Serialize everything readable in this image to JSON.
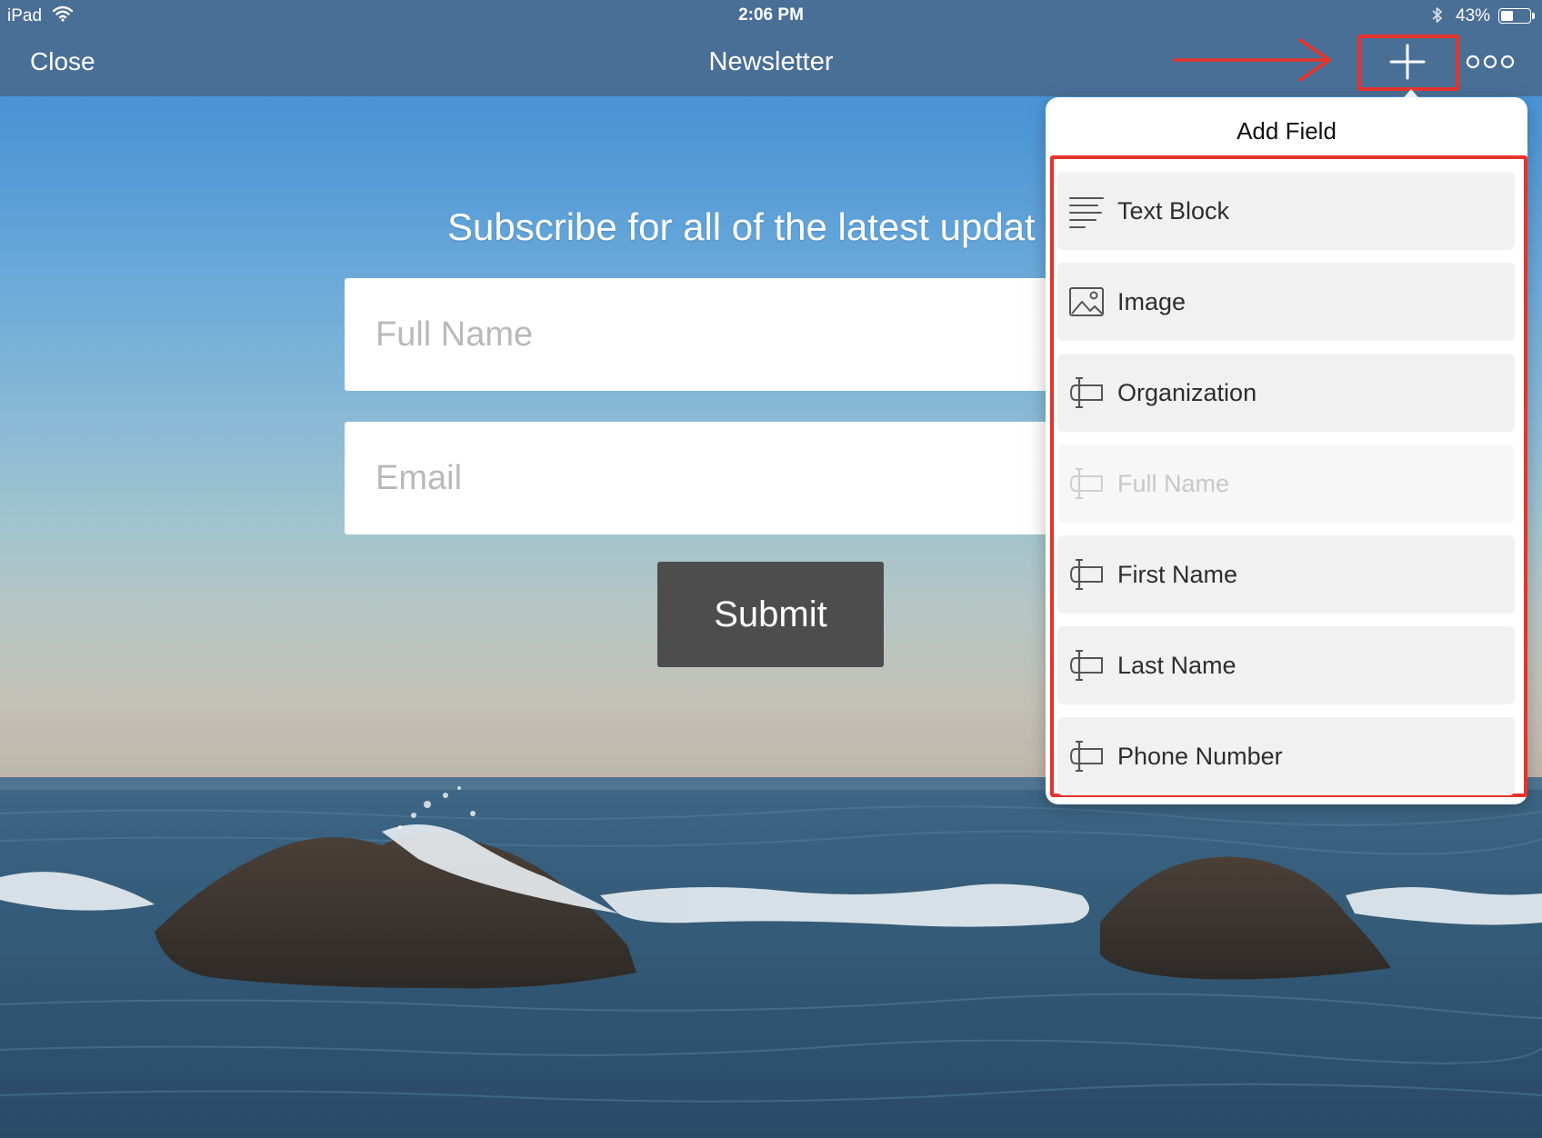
{
  "status_bar": {
    "device": "iPad",
    "time": "2:06 PM",
    "battery_percent": "43%",
    "battery_level": 0.43
  },
  "nav": {
    "close_label": "Close",
    "title": "Newsletter",
    "add_icon": "plus-icon",
    "more_icon": "more-dots-icon"
  },
  "form": {
    "heading": "Subscribe for all of the latest updat",
    "fullname_placeholder": "Full Name",
    "email_placeholder": "Email",
    "submit_label": "Submit"
  },
  "popover": {
    "title": "Add Field",
    "items": [
      {
        "label": "Text Block",
        "icon": "text-block-icon",
        "disabled": false
      },
      {
        "label": "Image",
        "icon": "image-icon",
        "disabled": false
      },
      {
        "label": "Organization",
        "icon": "text-field-icon",
        "disabled": false
      },
      {
        "label": "Full Name",
        "icon": "text-field-icon",
        "disabled": true
      },
      {
        "label": "First Name",
        "icon": "text-field-icon",
        "disabled": false
      },
      {
        "label": "Last Name",
        "icon": "text-field-icon",
        "disabled": false
      },
      {
        "label": "Phone Number",
        "icon": "text-field-icon",
        "disabled": false
      }
    ]
  },
  "colors": {
    "nav_bar": "#4a6f97",
    "annotation_red": "#e8332b",
    "submit_button": "#4d4d4d",
    "field_item_bg": "#f1f1f1"
  }
}
